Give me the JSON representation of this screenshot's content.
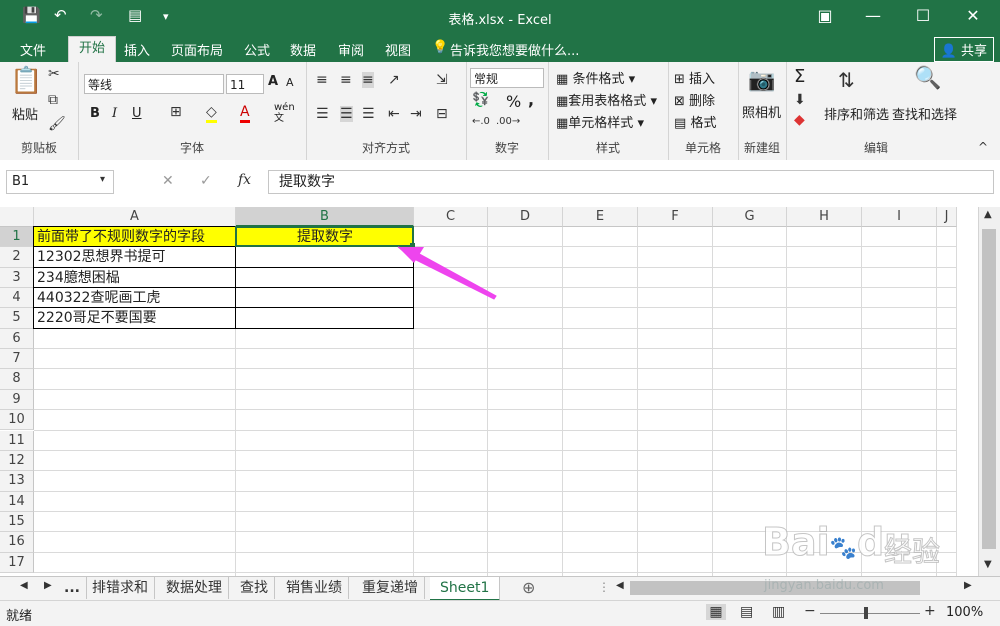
{
  "window": {
    "title": "表格.xlsx - Excel"
  },
  "tabs": [
    "文件",
    "开始",
    "插入",
    "页面布局",
    "公式",
    "数据",
    "审阅",
    "视图"
  ],
  "active_tab": "开始",
  "tell_me": "告诉我您想要做什么...",
  "share_label": "共享",
  "ribbon": {
    "clipboard": {
      "paste": "粘贴",
      "label": "剪贴板"
    },
    "font": {
      "name": "等线",
      "size": "11",
      "label": "字体",
      "bold": "B",
      "italic": "I",
      "underline": "U",
      "grow": "A",
      "shrink": "A",
      "wen": "wén\n文"
    },
    "alignment": {
      "label": "对齐方式"
    },
    "number": {
      "format": "常规",
      "label": "数字",
      "percent": "%",
      "comma": ","
    },
    "styles": {
      "conditional": "条件格式",
      "table": "套用表格格式",
      "cell": "单元格样式",
      "label": "样式"
    },
    "cells": {
      "insert": "插入",
      "delete": "删除",
      "format": "格式",
      "label": "单元格"
    },
    "camera": {
      "name": "照相机",
      "label": "新建组"
    },
    "editing": {
      "sort": "排序和筛选",
      "find": "查找和选择",
      "label": "编辑",
      "sigma": "Σ"
    }
  },
  "formula_bar": {
    "name_box": "B1",
    "fx": "fx",
    "content": "提取数字"
  },
  "columns": [
    "A",
    "B",
    "C",
    "D",
    "E",
    "F",
    "G",
    "H",
    "I",
    "J"
  ],
  "rows": [
    "1",
    "2",
    "3",
    "4",
    "5",
    "6",
    "7",
    "8",
    "9",
    "10",
    "11",
    "12",
    "13",
    "14",
    "15",
    "16",
    "17"
  ],
  "cells": {
    "A1": "前面带了不规则数字的字段",
    "B1": "提取数字",
    "A2": "12302思想界书提可",
    "A3": "234臆想困榀",
    "A4": "440322查呢画工虎",
    "A5": "2220哥足不要国要"
  },
  "sheet_tabs": [
    "...",
    "排错求和",
    "数据处理",
    "查找",
    "销售业绩",
    "重复递增",
    "Sheet1"
  ],
  "active_sheet": "Sheet1",
  "status": {
    "ready": "就绪",
    "zoom": "100%"
  },
  "watermark": {
    "brand": "Bai",
    "brand2": "du",
    "cn": "经验",
    "url": "jingyan.baidu.com"
  },
  "colors": {
    "excel_green": "#217346",
    "highlight": "#ffff00",
    "arrow": "#ee44ee"
  }
}
